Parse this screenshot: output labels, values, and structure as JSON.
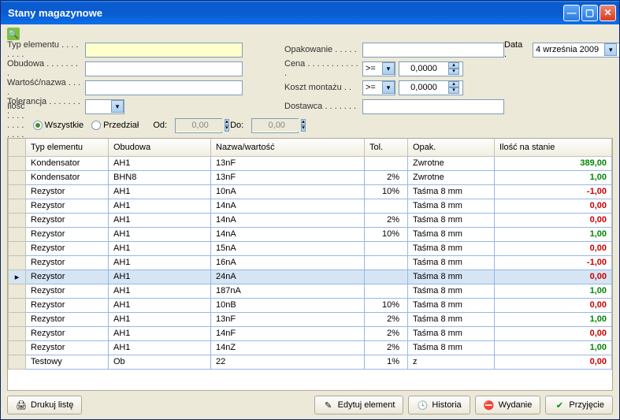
{
  "window": {
    "title": "Stany magazynowe"
  },
  "filters": {
    "typ_label": "Typ elementu . . . . . . . .",
    "obudowa_label": "Obudowa . . . . . . . .",
    "wartosc_label": "Wartość/nazwa . . . .",
    "tolerancja_label": "Tolerancja . . . . . . . .",
    "ilosc_label": "Ilość . . . . . . . . . . . . .",
    "opakowanie_label": "Opakowanie . . . . .",
    "cena_label": "Cena . . . . . . . . . . . .",
    "koszt_label": "Koszt montażu . .",
    "dostawca_label": "Dostawca . . . . . . .",
    "data_label": "Data .",
    "wszystkie": "Wszystkie",
    "przedzial": "Przedział",
    "od": "Od:",
    "do": "Do:",
    "od_val": "0,00",
    "do_val": "0,00",
    "cena_op": ">=",
    "cena_val": "0,0000",
    "koszt_op": ">=",
    "koszt_val": "0,0000",
    "date": "4   września   2009"
  },
  "columns": {
    "typ": "Typ elementu",
    "obudowa": "Obudowa",
    "nazwa": "Nazwa/wartość",
    "tol": "Tol.",
    "opak": "Opak.",
    "ilosc": "Ilość na stanie"
  },
  "rows": [
    {
      "typ": "Kondensator",
      "obudowa": "AH1",
      "nazwa": "13nF",
      "tol": "",
      "opak": "Zwrotne",
      "ilosc": "389,00",
      "c": "green"
    },
    {
      "typ": "Kondensator",
      "obudowa": "BHN8",
      "nazwa": "13nF",
      "tol": "2%",
      "opak": "Zwrotne",
      "ilosc": "1,00",
      "c": "green"
    },
    {
      "typ": "Rezystor",
      "obudowa": "AH1",
      "nazwa": "10nA",
      "tol": "10%",
      "opak": "Taśma 8 mm",
      "ilosc": "-1,00",
      "c": "red"
    },
    {
      "typ": "Rezystor",
      "obudowa": "AH1",
      "nazwa": "14nA",
      "tol": "",
      "opak": "Taśma 8 mm",
      "ilosc": "0,00",
      "c": "red"
    },
    {
      "typ": "Rezystor",
      "obudowa": "AH1",
      "nazwa": "14nA",
      "tol": "2%",
      "opak": "Taśma 8 mm",
      "ilosc": "0,00",
      "c": "red"
    },
    {
      "typ": "Rezystor",
      "obudowa": "AH1",
      "nazwa": "14nA",
      "tol": "10%",
      "opak": "Taśma 8 mm",
      "ilosc": "1,00",
      "c": "green"
    },
    {
      "typ": "Rezystor",
      "obudowa": "AH1",
      "nazwa": "15nA",
      "tol": "",
      "opak": "Taśma 8 mm",
      "ilosc": "0,00",
      "c": "red"
    },
    {
      "typ": "Rezystor",
      "obudowa": "AH1",
      "nazwa": "16nA",
      "tol": "",
      "opak": "Taśma 8 mm",
      "ilosc": "-1,00",
      "c": "red"
    },
    {
      "typ": "Rezystor",
      "obudowa": "AH1",
      "nazwa": "24nA",
      "tol": "",
      "opak": "Taśma 8 mm",
      "ilosc": "0,00",
      "c": "red",
      "sel": true
    },
    {
      "typ": "Rezystor",
      "obudowa": "AH1",
      "nazwa": "187nA",
      "tol": "",
      "opak": "Taśma 8 mm",
      "ilosc": "1,00",
      "c": "green"
    },
    {
      "typ": "Rezystor",
      "obudowa": "AH1",
      "nazwa": "10nB",
      "tol": "10%",
      "opak": "Taśma 8 mm",
      "ilosc": "0,00",
      "c": "red"
    },
    {
      "typ": "Rezystor",
      "obudowa": "AH1",
      "nazwa": "13nF",
      "tol": "2%",
      "opak": "Taśma 8 mm",
      "ilosc": "1,00",
      "c": "green"
    },
    {
      "typ": "Rezystor",
      "obudowa": "AH1",
      "nazwa": "14nF",
      "tol": "2%",
      "opak": "Taśma 8 mm",
      "ilosc": "0,00",
      "c": "red"
    },
    {
      "typ": "Rezystor",
      "obudowa": "AH1",
      "nazwa": "14nZ",
      "tol": "2%",
      "opak": "Taśma 8 mm",
      "ilosc": "1,00",
      "c": "green"
    },
    {
      "typ": "Testowy",
      "obudowa": "Ob",
      "nazwa": "22",
      "tol": "1%",
      "opak": "z",
      "ilosc": "0,00",
      "c": "red"
    }
  ],
  "footer": {
    "drukuj": "Drukuj listę",
    "edytuj": "Edytuj element",
    "historia": "Historia",
    "wydanie": "Wydanie",
    "przyjecie": "Przyjęcie"
  }
}
